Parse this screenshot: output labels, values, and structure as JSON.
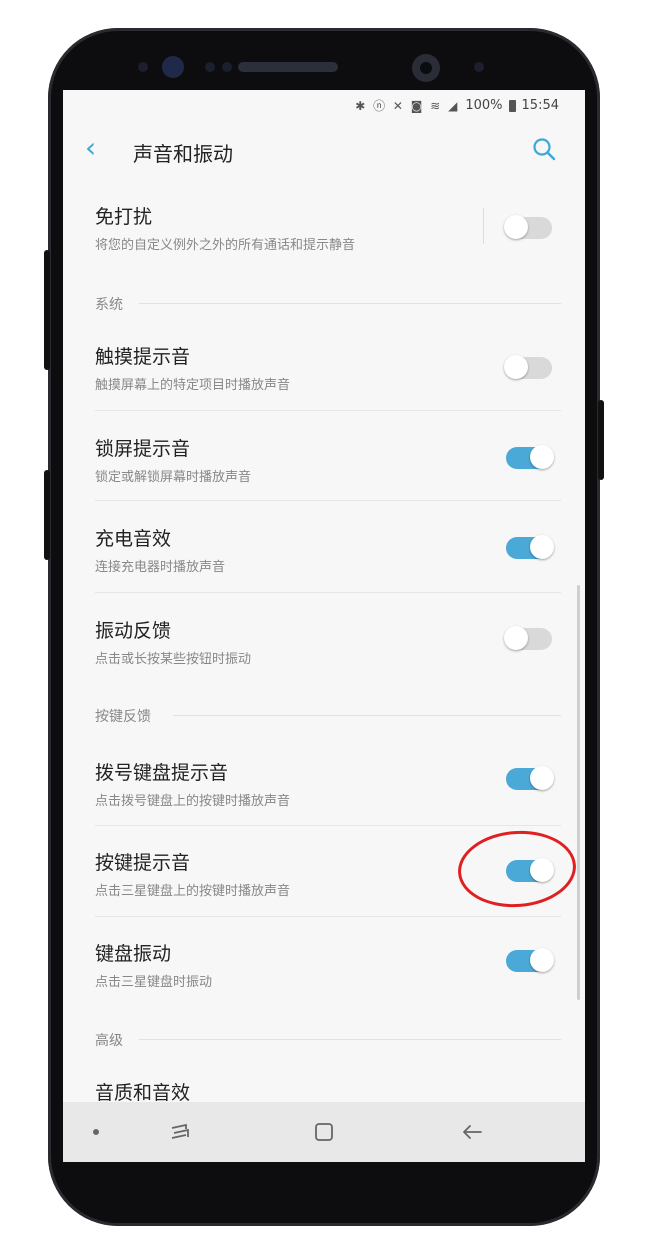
{
  "status_bar": {
    "icons": "✱ ⓝ ✕ ◙ ≋ ◢",
    "battery": "100%",
    "time": "15:54"
  },
  "header": {
    "title": "声音和振动"
  },
  "rows": {
    "dnd": {
      "title": "免打扰",
      "subtitle": "将您的自定义例外之外的所有通话和提示静音",
      "on": false
    },
    "touch": {
      "title": "触摸提示音",
      "subtitle": "触摸屏幕上的特定项目时播放声音",
      "on": false
    },
    "lock": {
      "title": "锁屏提示音",
      "subtitle": "锁定或解锁屏幕时播放声音",
      "on": true
    },
    "charge": {
      "title": "充电音效",
      "subtitle": "连接充电器时播放声音",
      "on": true
    },
    "haptic": {
      "title": "振动反馈",
      "subtitle": "点击或长按某些按钮时振动",
      "on": false
    },
    "dialpad": {
      "title": "拨号键盘提示音",
      "subtitle": "点击拨号键盘上的按键时播放声音",
      "on": true
    },
    "keytone": {
      "title": "按键提示音",
      "subtitle": "点击三星键盘上的按键时播放声音",
      "on": true
    },
    "keyvib": {
      "title": "键盘振动",
      "subtitle": "点击三星键盘时振动",
      "on": true
    },
    "quality": {
      "title": "音质和音效"
    }
  },
  "sections": {
    "system": "系统",
    "keyfeedback": "按键反馈",
    "advanced": "高级"
  },
  "colors": {
    "accent": "#4aa9d6",
    "highlight": "#e02020"
  }
}
